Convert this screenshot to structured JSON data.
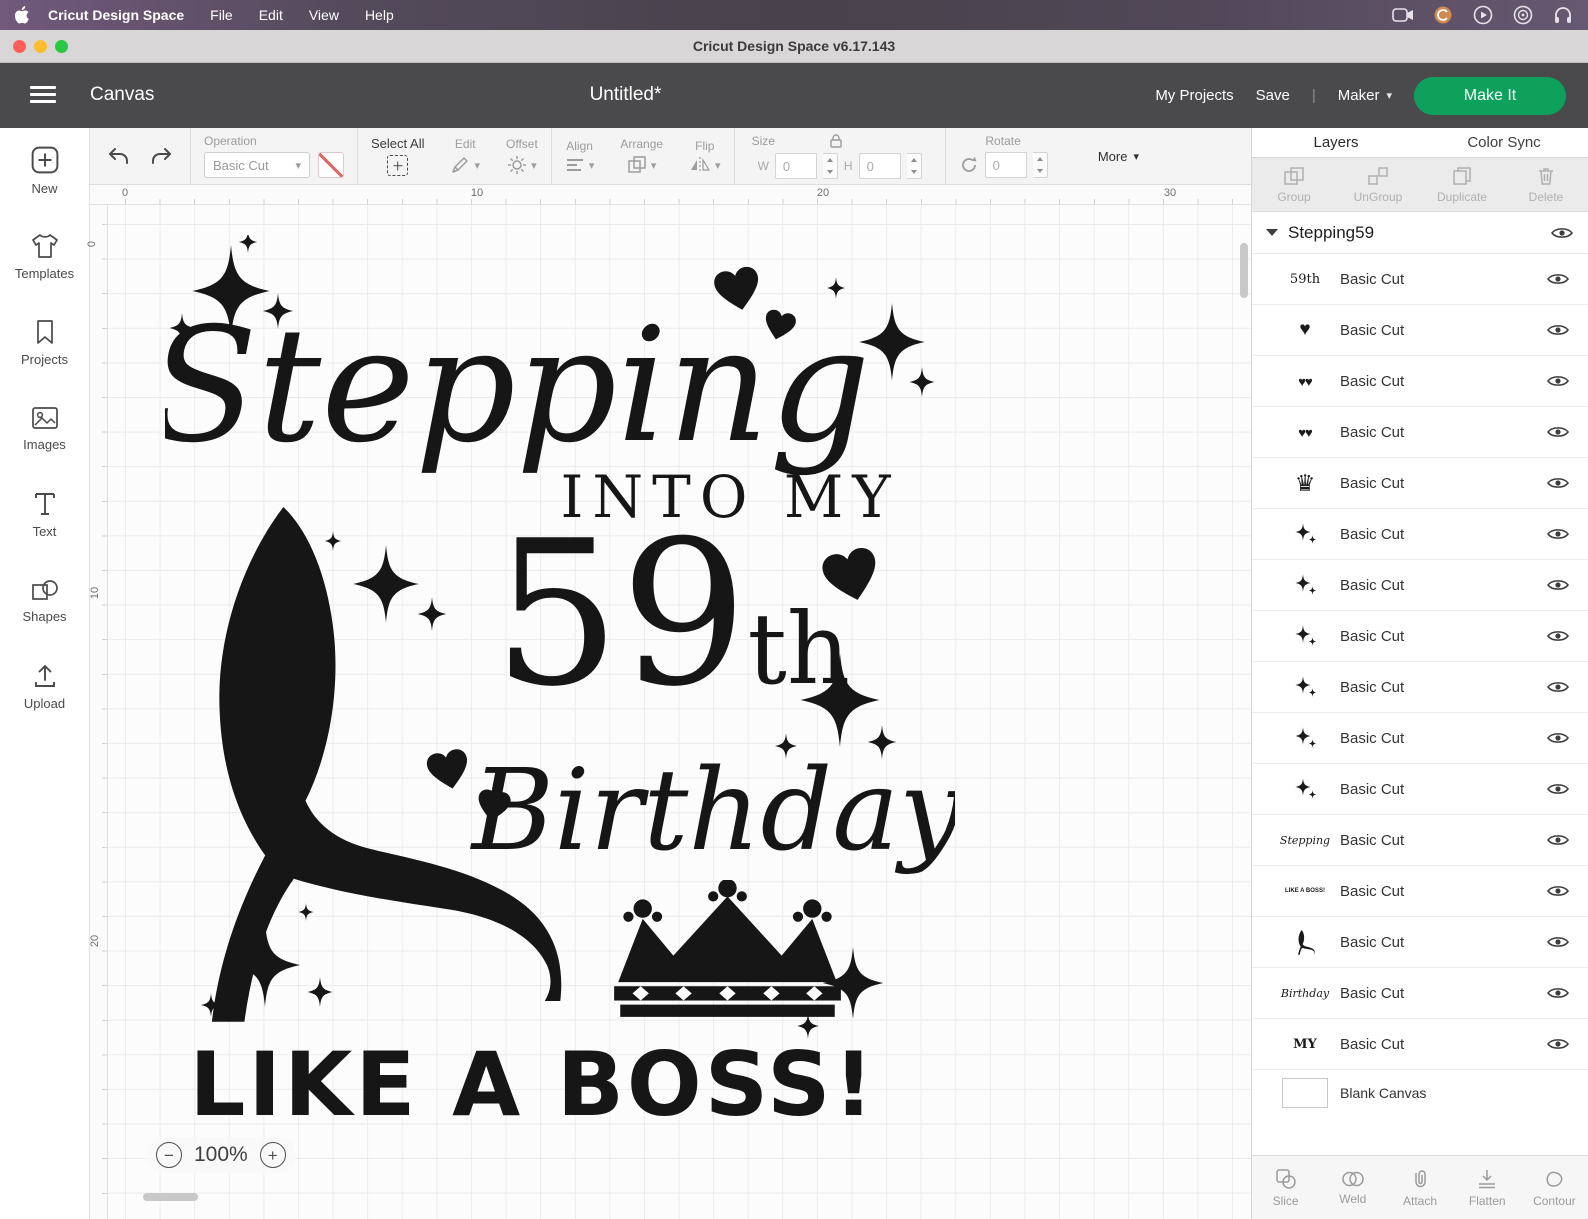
{
  "menubar": {
    "app_name": "Cricut Design Space",
    "items": [
      "File",
      "Edit",
      "View",
      "Help"
    ]
  },
  "titlebar": {
    "title": "Cricut Design Space  v6.17.143"
  },
  "header": {
    "canvas_label": "Canvas",
    "doc_title": "Untitled*",
    "my_projects": "My Projects",
    "save": "Save",
    "divider": "|",
    "machine": "Maker",
    "make_it": "Make It"
  },
  "toolbar": {
    "operation_label": "Operation",
    "operation_value": "Basic Cut",
    "select_all": "Select All",
    "edit": "Edit",
    "offset": "Offset",
    "align": "Align",
    "arrange": "Arrange",
    "flip": "Flip",
    "size_label": "Size",
    "w_label": "W",
    "h_label": "H",
    "w_value": "0",
    "h_value": "0",
    "rotate_label": "Rotate",
    "rotate_value": "0",
    "more": "More"
  },
  "sidebar": {
    "items": [
      {
        "label": "New"
      },
      {
        "label": "Templates"
      },
      {
        "label": "Projects"
      },
      {
        "label": "Images"
      },
      {
        "label": "Text"
      },
      {
        "label": "Shapes"
      },
      {
        "label": "Upload"
      }
    ]
  },
  "canvas": {
    "ruler_h": [
      "0",
      "10",
      "20",
      "30"
    ],
    "ruler_v": [
      "0",
      "10",
      "20"
    ],
    "zoom": "100%",
    "design": {
      "script1": "Stepping",
      "line2": "INTO MY",
      "num": "59",
      "suffix": "th",
      "script2": "Birthday",
      "line5": "LIKE A BOSS!"
    }
  },
  "layers": {
    "tabs": [
      "Layers",
      "Color Sync"
    ],
    "actions": [
      "Group",
      "UnGroup",
      "Duplicate",
      "Delete"
    ],
    "group_name": "Stepping59",
    "items": [
      {
        "thumb": "59th",
        "label": "Basic Cut"
      },
      {
        "thumb": "♥",
        "label": "Basic Cut"
      },
      {
        "thumb": "♥♥",
        "label": "Basic Cut"
      },
      {
        "thumb": "♥♥",
        "label": "Basic Cut"
      },
      {
        "thumb": "♛",
        "label": "Basic Cut"
      },
      {
        "thumb": "sparkle-icon",
        "label": "Basic Cut"
      },
      {
        "thumb": "sparkle-icon",
        "label": "Basic Cut"
      },
      {
        "thumb": "sparkle-icon",
        "label": "Basic Cut"
      },
      {
        "thumb": "sparkle-icon",
        "label": "Basic Cut"
      },
      {
        "thumb": "sparkle-icon",
        "label": "Basic Cut"
      },
      {
        "thumb": "sparkle-icon",
        "label": "Basic Cut"
      },
      {
        "thumb": "Stepping",
        "label": "Basic Cut"
      },
      {
        "thumb": "LIKE A BOSS!",
        "label": "Basic Cut"
      },
      {
        "thumb": "heel-icon",
        "label": "Basic Cut"
      },
      {
        "thumb": "Birthday",
        "label": "Basic Cut"
      },
      {
        "thumb": "MY",
        "label": "Basic Cut"
      }
    ],
    "blank_canvas": "Blank Canvas"
  },
  "bottom_tools": {
    "items": [
      {
        "label": "Slice"
      },
      {
        "label": "Weld"
      },
      {
        "label": "Attach"
      },
      {
        "label": "Flatten"
      },
      {
        "label": "Contour"
      }
    ]
  },
  "icons": {
    "minus": "−",
    "plus": "+",
    "chevron_down": "▾"
  }
}
